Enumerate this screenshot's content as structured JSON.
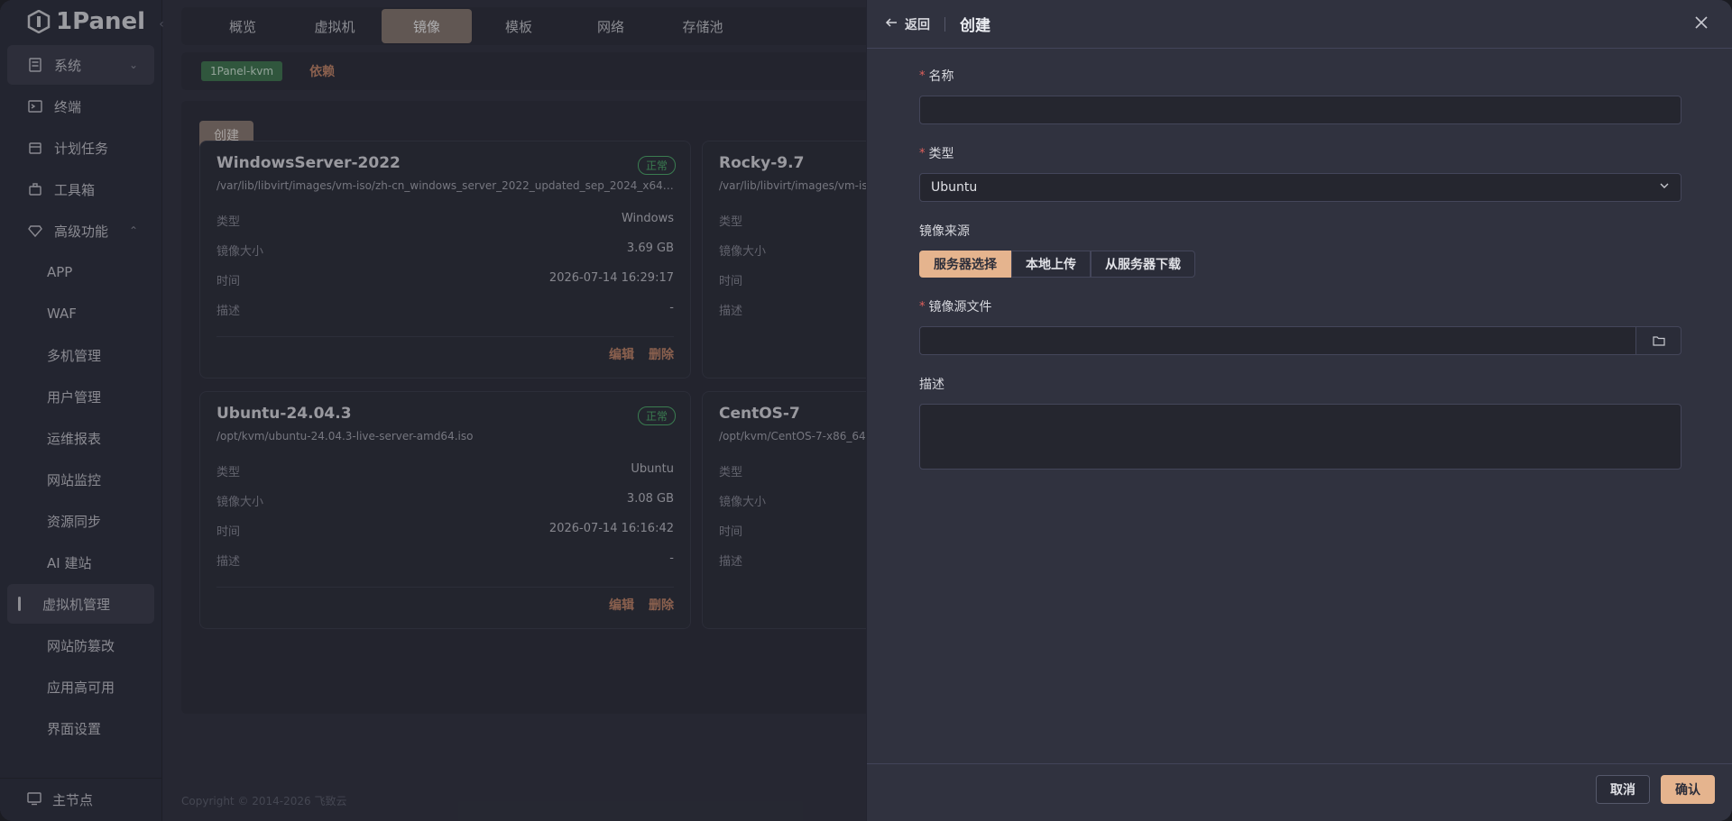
{
  "app": {
    "logo": "1Panel"
  },
  "sidebar": {
    "items": [
      {
        "label": "系统",
        "icon": "server-icon"
      },
      {
        "label": "终端",
        "icon": "terminal-icon"
      },
      {
        "label": "计划任务",
        "icon": "calendar-icon"
      },
      {
        "label": "工具箱",
        "icon": "toolbox-icon"
      },
      {
        "label": "高级功能",
        "icon": "diamond-icon"
      }
    ],
    "sub_items": [
      "APP",
      "WAF",
      "多机管理",
      "用户管理",
      "运维报表",
      "网站监控",
      "资源同步",
      "AI 建站",
      "虚拟机管理",
      "网站防篡改",
      "应用高可用",
      "界面设置"
    ],
    "footer": "主节点"
  },
  "tabs": [
    "概览",
    "虚拟机",
    "镜像",
    "模板",
    "网络",
    "存储池"
  ],
  "subbar": {
    "tag": "1Panel-kvm",
    "link": "依赖"
  },
  "content": {
    "create_label": "创建",
    "cards": [
      {
        "title": "WindowsServer-2022",
        "status": "正常",
        "path": "/var/lib/libvirt/images/vm-iso/zh-cn_windows_server_2022_updated_sep_2024_x64_d...",
        "type_k": "类型",
        "type_v": "Windows",
        "size_k": "镜像大小",
        "size_v": "3.69 GB",
        "time_k": "时间",
        "time_v": "2026-07-14 16:29:17",
        "desc_k": "描述",
        "desc_v": "-",
        "edit": "编辑",
        "del": "删除"
      },
      {
        "title": "Rocky-9.7",
        "status": "",
        "path": "/var/lib/libvirt/images/vm-iso/",
        "type_k": "类型",
        "type_v": "",
        "size_k": "镜像大小",
        "size_v": "",
        "time_k": "时间",
        "time_v": "",
        "desc_k": "描述",
        "desc_v": "",
        "edit": "",
        "del": ""
      },
      {
        "title": "Ubuntu-24.04.3",
        "status": "正常",
        "path": "/opt/kvm/ubuntu-24.04.3-live-server-amd64.iso",
        "type_k": "类型",
        "type_v": "Ubuntu",
        "size_k": "镜像大小",
        "size_v": "3.08 GB",
        "time_k": "时间",
        "time_v": "2026-07-14 16:16:42",
        "desc_k": "描述",
        "desc_v": "-",
        "edit": "编辑",
        "del": "删除"
      },
      {
        "title": "CentOS-7",
        "status": "",
        "path": "/opt/kvm/CentOS-7-x86_64",
        "type_k": "类型",
        "type_v": "",
        "size_k": "镜像大小",
        "size_v": "",
        "time_k": "时间",
        "time_v": "",
        "desc_k": "描述",
        "desc_v": "",
        "edit": "",
        "del": ""
      }
    ],
    "copyright": "Copyright © 2014-2026 飞致云"
  },
  "drawer": {
    "back": "返回",
    "title": "创建",
    "fields": {
      "name_label": "名称",
      "name_value": "",
      "type_label": "类型",
      "type_value": "Ubuntu",
      "source_label": "镜像来源",
      "source_options": [
        "服务器选择",
        "本地上传",
        "从服务器下载"
      ],
      "source_selected": "服务器选择",
      "file_label": "镜像源文件",
      "file_value": "",
      "desc_label": "描述",
      "desc_value": ""
    },
    "cancel": "取消",
    "confirm": "确认"
  },
  "colors": {
    "accent": "#e5b48e",
    "status_green": "#4fb46d",
    "required": "#e0605c"
  }
}
